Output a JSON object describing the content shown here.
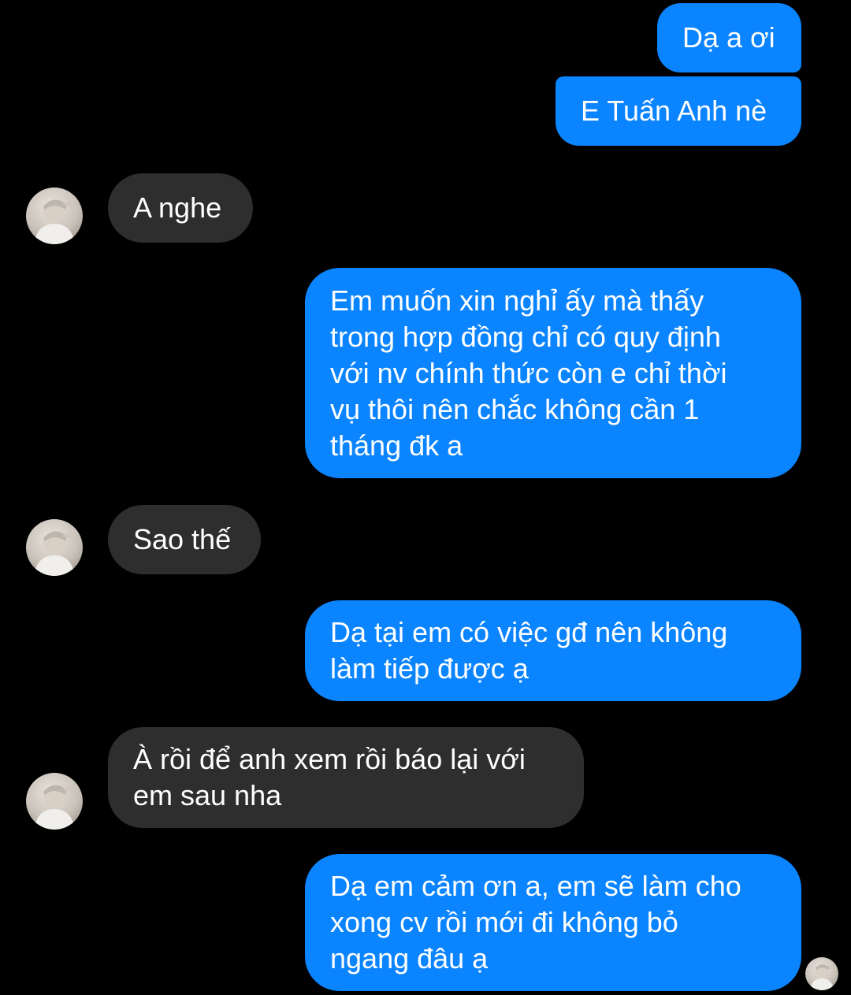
{
  "messages": [
    {
      "direction": "outgoing",
      "text": "Dạ a ơi"
    },
    {
      "direction": "outgoing",
      "text": "E Tuấn Anh nè"
    },
    {
      "direction": "incoming",
      "text": "A nghe"
    },
    {
      "direction": "outgoing",
      "text": "Em muốn xin nghỉ ấy mà thấy\ntrong hợp đồng chỉ có quy định\nvới nv chính thức còn e chỉ thời\nvụ thôi nên chắc không cần 1\ntháng đk a"
    },
    {
      "direction": "incoming",
      "text": "Sao thế"
    },
    {
      "direction": "outgoing",
      "text": "Dạ tại em có việc gđ nên không\nlàm tiếp được ạ"
    },
    {
      "direction": "incoming",
      "text": "À rồi để anh xem rồi báo lại với\nem sau nha"
    },
    {
      "direction": "outgoing",
      "text": "Dạ em cảm ơn a, em sẽ làm cho\nxong cv rồi mới đi không bỏ\nngang đâu ạ"
    }
  ],
  "colors": {
    "background": "#000000",
    "outgoing_bubble": "#0a84ff",
    "incoming_bubble": "#2e2e2e",
    "text": "#ffffff"
  },
  "icons": {
    "contact_avatar": "contact-avatar",
    "seen_receipt": "seen-avatar"
  }
}
